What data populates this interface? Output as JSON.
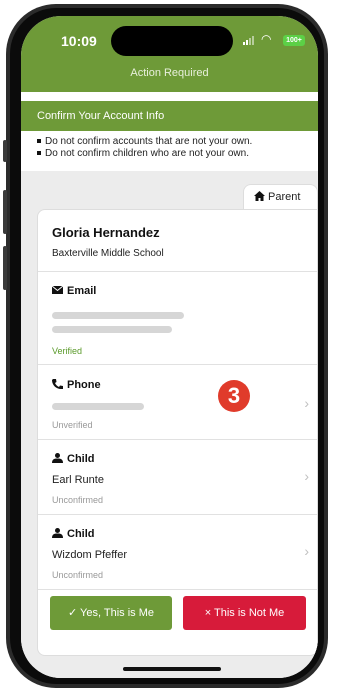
{
  "status_bar": {
    "time": "10:09",
    "battery": "100+",
    "signal_icon": "cell-signal-icon",
    "wifi_icon": "wifi-icon",
    "battery_icon": "battery-icon"
  },
  "nav": {
    "title": "Action Required"
  },
  "section": {
    "title": "Confirm Your Account Info",
    "notes": [
      "Do not confirm accounts that are not your own.",
      "Do not confirm children who are not your own."
    ]
  },
  "tab": {
    "label": "Parent",
    "icon": "home-icon"
  },
  "profile": {
    "name": "Gloria Hernandez",
    "school": "Baxterville Middle School"
  },
  "email": {
    "label": "Email",
    "status": "Verified",
    "icon": "envelope-icon"
  },
  "phone": {
    "label": "Phone",
    "status": "Unverified",
    "icon": "phone-icon"
  },
  "children": [
    {
      "label": "Child",
      "name": "Earl Runte",
      "status": "Unconfirmed",
      "icon": "person-icon"
    },
    {
      "label": "Child",
      "name": "Wizdom Pfeffer",
      "status": "Unconfirmed",
      "icon": "person-icon"
    }
  ],
  "annotation": {
    "badge": "3"
  },
  "buttons": {
    "yes": "✓ Yes, This is Me",
    "no": "× This is Not Me"
  },
  "colors": {
    "brand_green": "#6e9a38",
    "danger_red": "#d71b3a",
    "badge_red": "#e03b2b",
    "verified_green": "#5a9a2a"
  }
}
